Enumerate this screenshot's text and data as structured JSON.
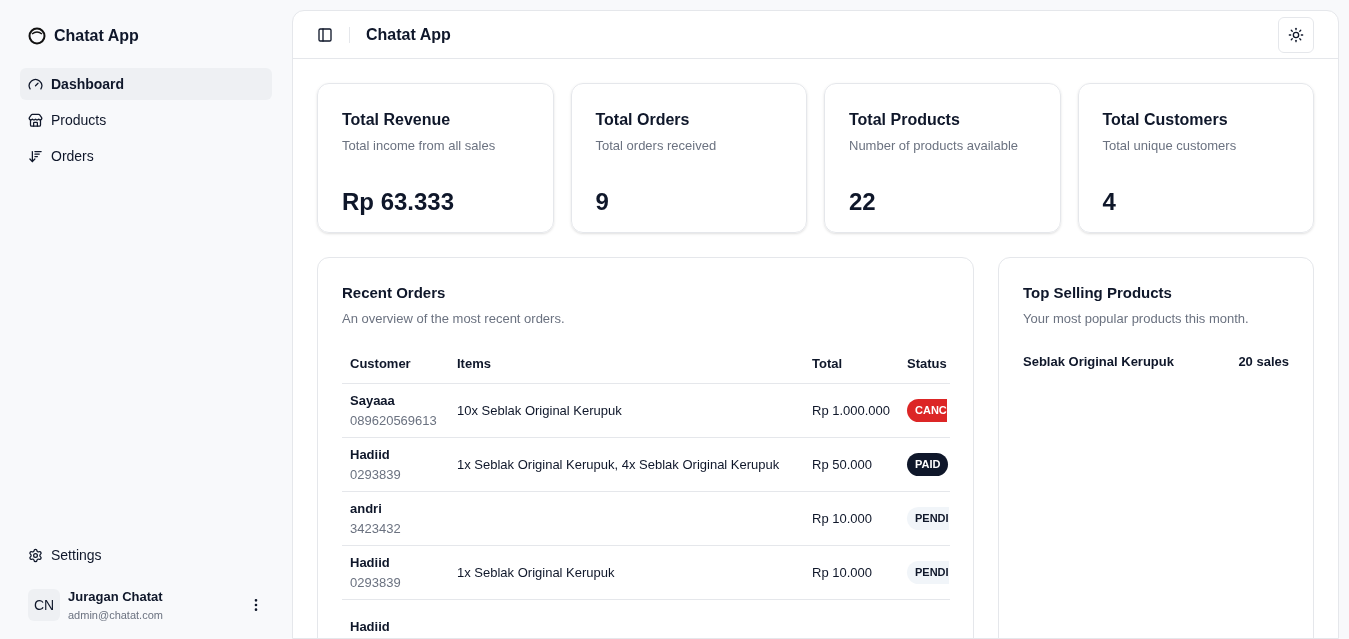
{
  "sidebar": {
    "app_name": "Chatat App",
    "items": [
      {
        "label": "Dashboard",
        "selected": true
      },
      {
        "label": "Products",
        "selected": false
      },
      {
        "label": "Orders",
        "selected": false
      }
    ],
    "settings": "Settings",
    "user": {
      "initials": "CN",
      "name": "Juragan Chatat",
      "email": "admin@chatat.com"
    }
  },
  "header": {
    "title": "Chatat App"
  },
  "stats": [
    {
      "title": "Total Revenue",
      "subtitle": "Total income from all sales",
      "value": "Rp 63.333"
    },
    {
      "title": "Total Orders",
      "subtitle": "Total orders received",
      "value": "9"
    },
    {
      "title": "Total Products",
      "subtitle": "Number of products available",
      "value": "22"
    },
    {
      "title": "Total Customers",
      "subtitle": "Total unique customers",
      "value": "4"
    }
  ],
  "recent_orders": {
    "title": "Recent Orders",
    "subtitle": "An overview of the most recent orders.",
    "columns": [
      "Customer",
      "Items",
      "Total",
      "Status"
    ],
    "rows": [
      {
        "name": "Sayaaa",
        "phone": "089620569613",
        "items": "10x Seblak Original Kerupuk",
        "total": "Rp 1.000.000",
        "status": "CANC",
        "kind": "cancelled"
      },
      {
        "name": "Hadiid",
        "phone": "0293839",
        "items": "1x Seblak Original Kerupuk, 4x Seblak Original Kerupuk",
        "total": "Rp 50.000",
        "status": "PAID",
        "kind": "paid"
      },
      {
        "name": "andri",
        "phone": "3423432",
        "total": "Rp 10.000",
        "status": "PENDI",
        "kind": "pending"
      },
      {
        "name": "Hadiid",
        "phone": "0293839",
        "items": "1x Seblak Original Kerupuk",
        "total": "Rp 10.000",
        "status": "PENDI",
        "kind": "pending"
      },
      {
        "name": "Hadiid"
      }
    ]
  },
  "top_selling": {
    "title": "Top Selling Products",
    "subtitle": "Your most popular products this month.",
    "items": [
      {
        "name": "Seblak Original Kerupuk",
        "sales": "20 sales"
      }
    ]
  }
}
